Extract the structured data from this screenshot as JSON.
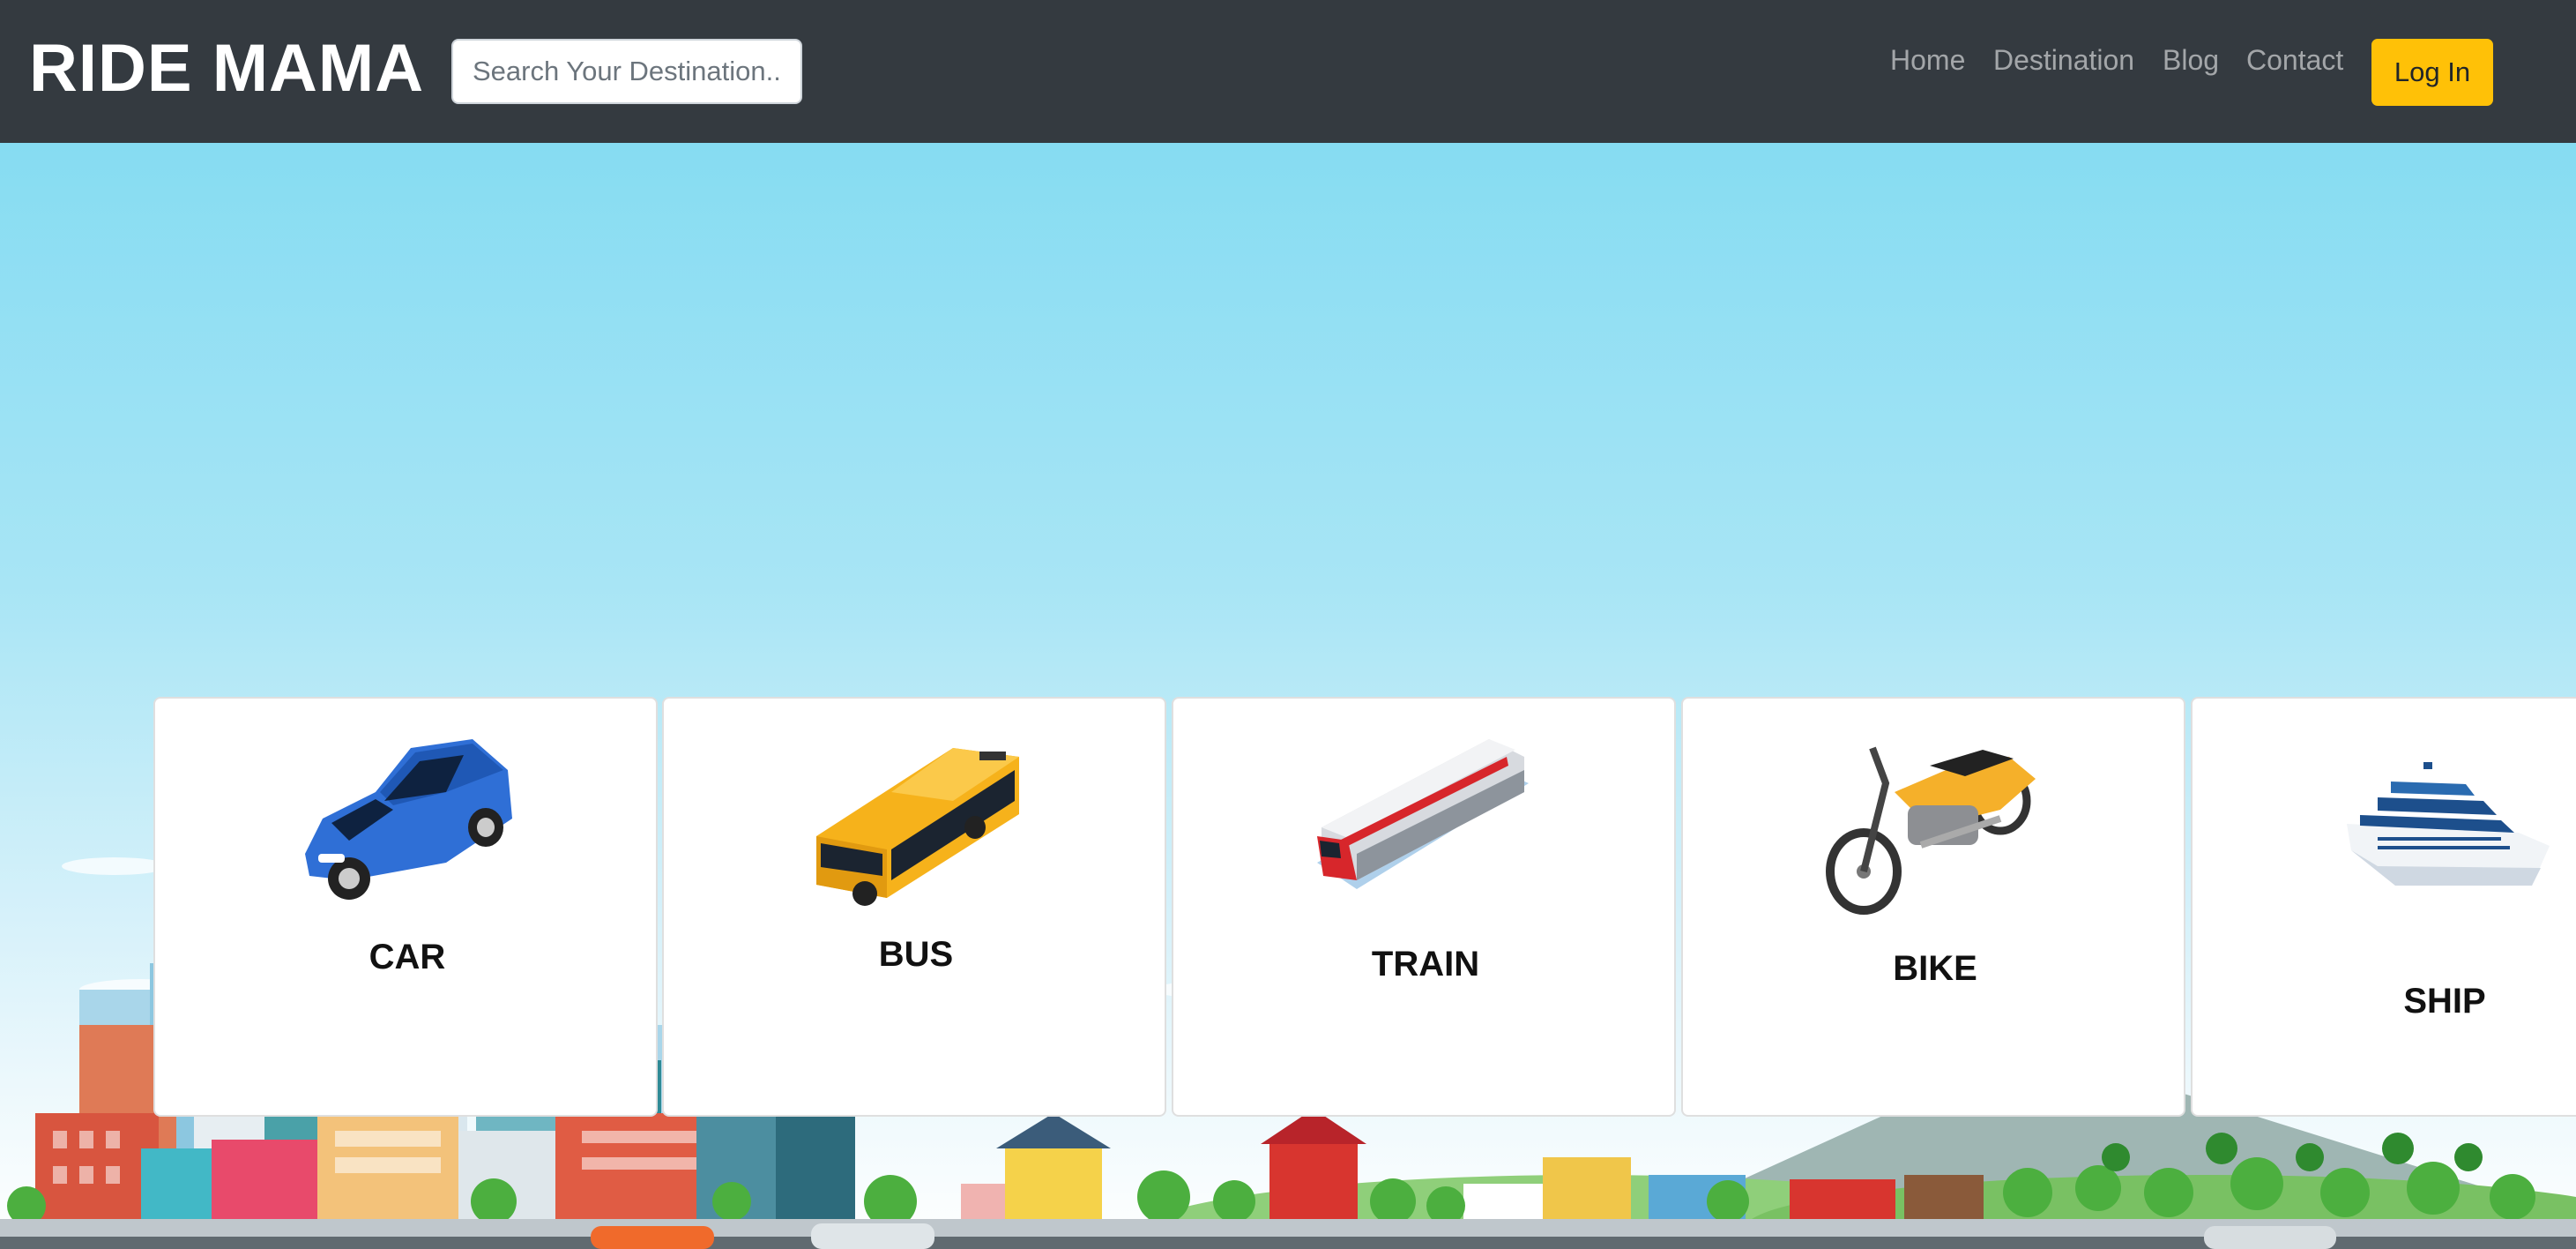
{
  "navbar": {
    "brand": "RIDE MAMA",
    "search_placeholder": "Search Your Destination..",
    "links": [
      "Home",
      "Destination",
      "Blog",
      "Contact"
    ],
    "login_label": "Log In",
    "background_color": "#343a40",
    "login_color": "#ffc107"
  },
  "vehicles": [
    {
      "label": "CAR",
      "icon": "car-icon",
      "color": "#2f6fd6"
    },
    {
      "label": "BUS",
      "icon": "bus-icon",
      "color": "#f6b21b"
    },
    {
      "label": "TRAIN",
      "icon": "train-icon",
      "color": "#d7262b"
    },
    {
      "label": "BIKE",
      "icon": "motorbike-icon",
      "color": "#f5b02a"
    },
    {
      "label": "SHIP",
      "icon": "ship-icon",
      "color": "#1d4f8c"
    }
  ],
  "hero": {
    "sky_color": "#86dcf2",
    "background": "city-skyline-illustration"
  }
}
